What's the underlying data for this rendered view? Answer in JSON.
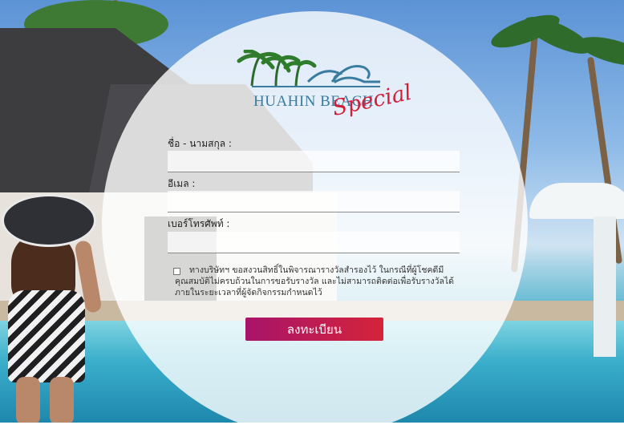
{
  "brand": {
    "name": "HUAHIN BEACH",
    "tagline": "Special"
  },
  "form": {
    "fullname_label": "ชื่อ - นามสกุล :",
    "fullname_value": "",
    "email_label": "อีเมล :",
    "email_value": "",
    "phone_label": "เบอร์โทรศัพท์ :",
    "phone_value": "",
    "consent_text": "ทางบริษัทฯ ขอสงวนสิทธิ์ในพิจารณารางวัลสำรองไว้ ในกรณีที่ผู้โชคดีมีคุณสมบัติไม่ครบถ้วนในการขอรับรางวัล และไม่สามารถติดต่อเพื่อรับรางวัลได้ภายในระยะเวลาที่ผู้จัดกิจกรรมกำหนดไว้",
    "consent_checked": false,
    "submit_label": "ลงทะเบียน"
  },
  "colors": {
    "button_start": "#a8146a",
    "button_end": "#d5243a",
    "logo_blue": "#3a7ca0",
    "logo_red": "#cf1f3a"
  }
}
